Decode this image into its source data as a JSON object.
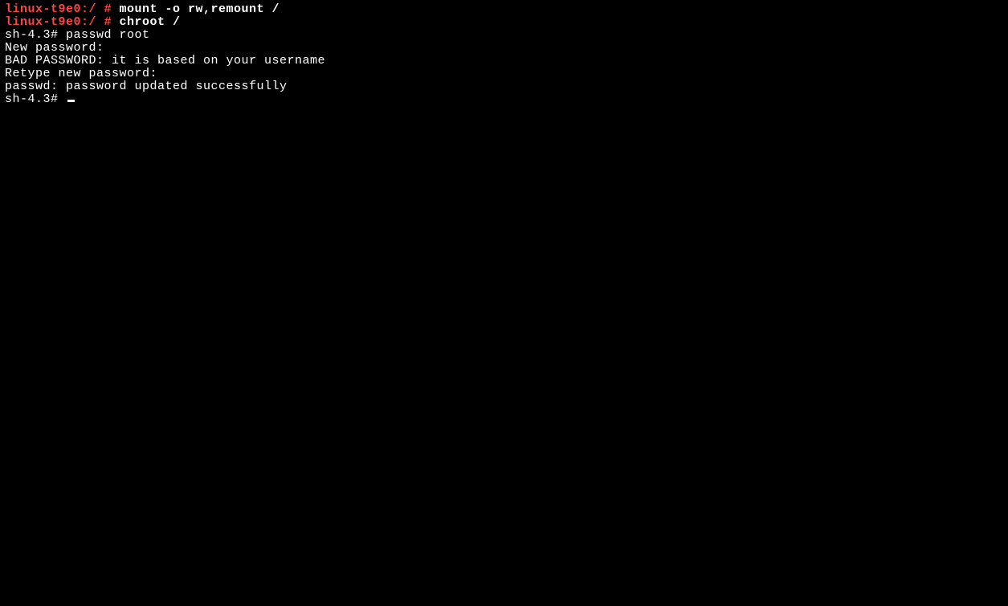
{
  "lines": [
    {
      "segments": [
        {
          "class": "prompt-red",
          "text": "linux-t9e0:/ #"
        },
        {
          "class": "white",
          "text": " mount -o rw,remount /"
        }
      ]
    },
    {
      "segments": [
        {
          "class": "prompt-red",
          "text": "linux-t9e0:/ #"
        },
        {
          "class": "white",
          "text": " chroot /"
        }
      ]
    },
    {
      "segments": [
        {
          "class": "normal",
          "text": "sh-4.3# passwd root"
        }
      ]
    },
    {
      "segments": [
        {
          "class": "normal",
          "text": "New password:"
        }
      ]
    },
    {
      "segments": [
        {
          "class": "normal",
          "text": "BAD PASSWORD: it is based on your username"
        }
      ]
    },
    {
      "segments": [
        {
          "class": "normal",
          "text": "Retype new password:"
        }
      ]
    },
    {
      "segments": [
        {
          "class": "normal",
          "text": "passwd: password updated successfully"
        }
      ]
    },
    {
      "segments": [
        {
          "class": "normal",
          "text": "sh-4.3# "
        }
      ],
      "cursor": true
    }
  ]
}
